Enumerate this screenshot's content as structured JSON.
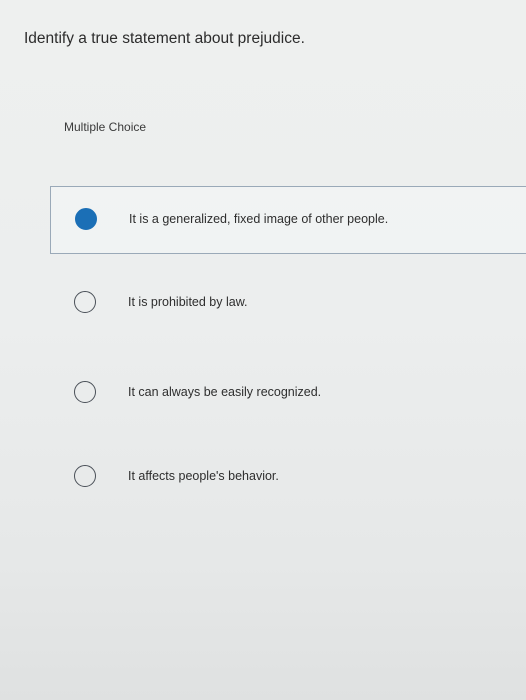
{
  "question": {
    "text": "Identify a true statement about prejudice.",
    "type_label": "Multiple Choice"
  },
  "options": [
    {
      "label": "It is a generalized, fixed image of other people.",
      "selected": true
    },
    {
      "label": "It is prohibited by law.",
      "selected": false
    },
    {
      "label": "It can always be easily recognized.",
      "selected": false
    },
    {
      "label": "It affects people's behavior.",
      "selected": false
    }
  ],
  "colors": {
    "selected_radio": "#1b6fb6",
    "selected_border": "#9aa9b8"
  }
}
